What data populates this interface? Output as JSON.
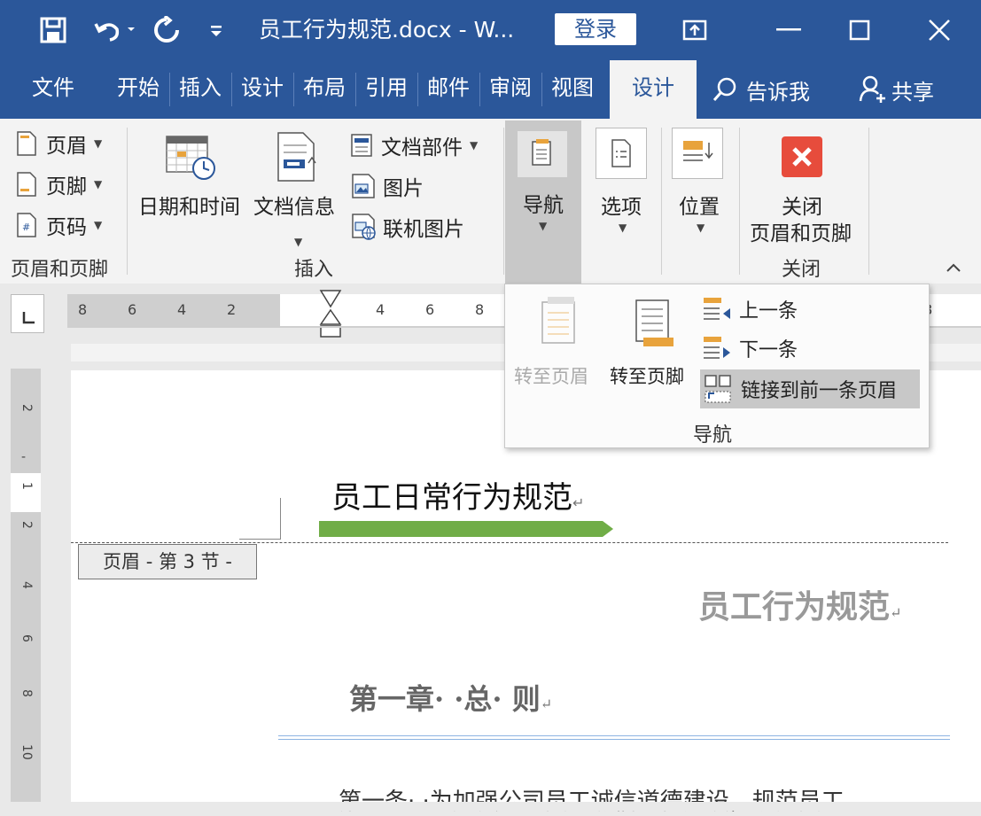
{
  "titlebar": {
    "title": "员工行为规范.docx  -  W...",
    "login": "登录"
  },
  "tabs": [
    {
      "label": "文件"
    },
    {
      "label": "开始"
    },
    {
      "label": "插入"
    },
    {
      "label": "设计"
    },
    {
      "label": "布局"
    },
    {
      "label": "引用"
    },
    {
      "label": "邮件"
    },
    {
      "label": "审阅"
    },
    {
      "label": "视图"
    },
    {
      "label": "设计"
    }
  ],
  "tell_me": "告诉我",
  "share": "共享",
  "ribbon": {
    "header_footer_group": {
      "header": "页眉",
      "footer": "页脚",
      "page_number": "页码",
      "label": "页眉和页脚"
    },
    "insert_group": {
      "datetime": "日期和时间",
      "docinfo": "文档信息",
      "quickparts": "文档部件",
      "picture": "图片",
      "online_picture": "联机图片",
      "label": "插入"
    },
    "navigation": "导航",
    "options": "选项",
    "position": "位置",
    "close_group": {
      "close_line1": "关闭",
      "close_line2": "页眉和页脚",
      "label": "关闭"
    }
  },
  "ruler": {
    "left_numbers": [
      "8",
      "6",
      "4",
      "2"
    ],
    "right_numbers": [
      "4",
      "6",
      "8"
    ],
    "far_right": "8",
    "vertical_numbers": [
      "2",
      "1",
      "1",
      "2",
      "4",
      "6",
      "8",
      "10"
    ]
  },
  "nav_dropdown": {
    "goto_header": "转至页眉",
    "goto_footer": "转至页脚",
    "previous": "上一条",
    "next": "下一条",
    "link_previous": "链接到前一条页眉",
    "label": "导航"
  },
  "document": {
    "header_title": "员工日常行为规范",
    "header_tag": "页眉 - 第 3 节 -",
    "doc_title": "员工行为规范",
    "chapter": "第一章·  ·总·  则",
    "first_article": "第一条·  ·为加强公司员工诚信道德建设，规范员工"
  },
  "colors": {
    "word_blue": "#2b579a",
    "green_bar": "#70ad47",
    "close_red": "#e74c3c"
  }
}
